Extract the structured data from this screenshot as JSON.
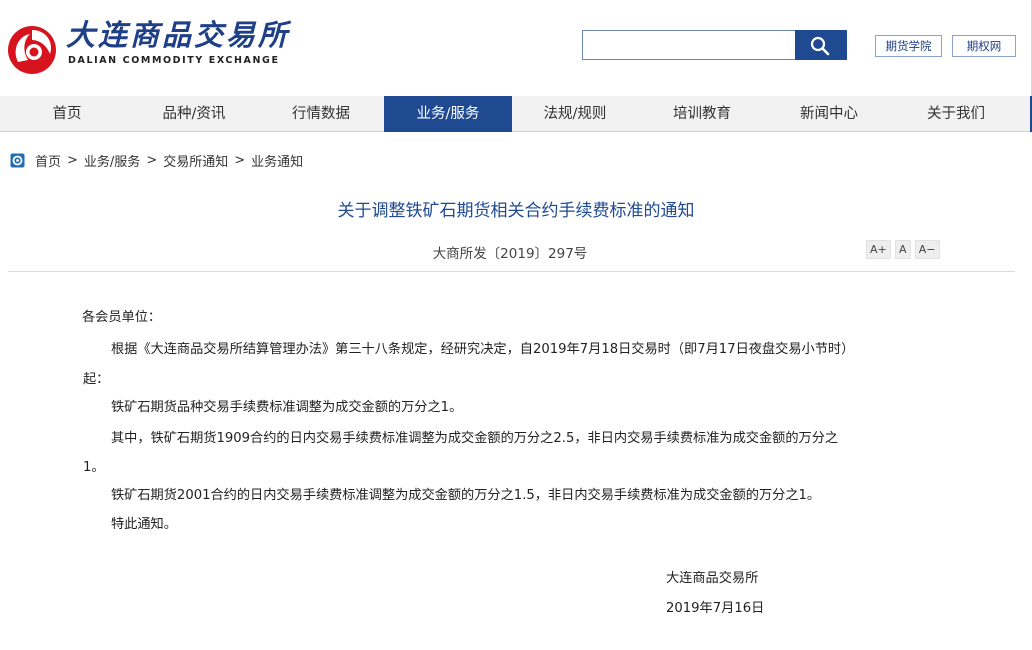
{
  "header": {
    "brand_cn": "大连商品交易所",
    "brand_en": "DALIAN COMMODITY EXCHANGE",
    "search": {
      "value": "",
      "placeholder": ""
    },
    "links": [
      "期货学院",
      "期权网"
    ]
  },
  "nav": {
    "items": [
      "首页",
      "品种/资讯",
      "行情数据",
      "业务/服务",
      "法规/规则",
      "培训教育",
      "新闻中心",
      "关于我们"
    ],
    "active": "业务/服务"
  },
  "breadcrumb": {
    "items": [
      "首页",
      "业务/服务",
      "交易所通知",
      "业务通知"
    ],
    "separator": ">"
  },
  "article": {
    "title": "关于调整铁矿石期货相关合约手续费标准的通知",
    "doc_number": "大商所发〔2019〕297号",
    "font_controls": [
      "A+",
      "A",
      "A−"
    ],
    "salutation": "各会员单位：",
    "lines": [
      "根据《大连商品交易所结算管理办法》第三十八条规定，经研究决定，自2019年7月18日交易时（即7月17日夜盘交易小节时）",
      "起：",
      "铁矿石期货品种交易手续费标准调整为成交金额的万分之1。",
      "其中，铁矿石期货1909合约的日内交易手续费标准调整为成交金额的万分之2.5，非日内交易手续费标准为成交金额的万分之",
      "1。",
      "铁矿石期货2001合约的日内交易手续费标准调整为成交金额的万分之1.5，非日内交易手续费标准为成交金额的万分之1。",
      "特此通知。"
    ],
    "signature": {
      "org": "大连商品交易所",
      "date": "2019年7月16日"
    }
  },
  "colors": {
    "brand_blue": "#1f4a92",
    "logo_red": "#d7141e",
    "title_blue": "#1f4a92"
  }
}
